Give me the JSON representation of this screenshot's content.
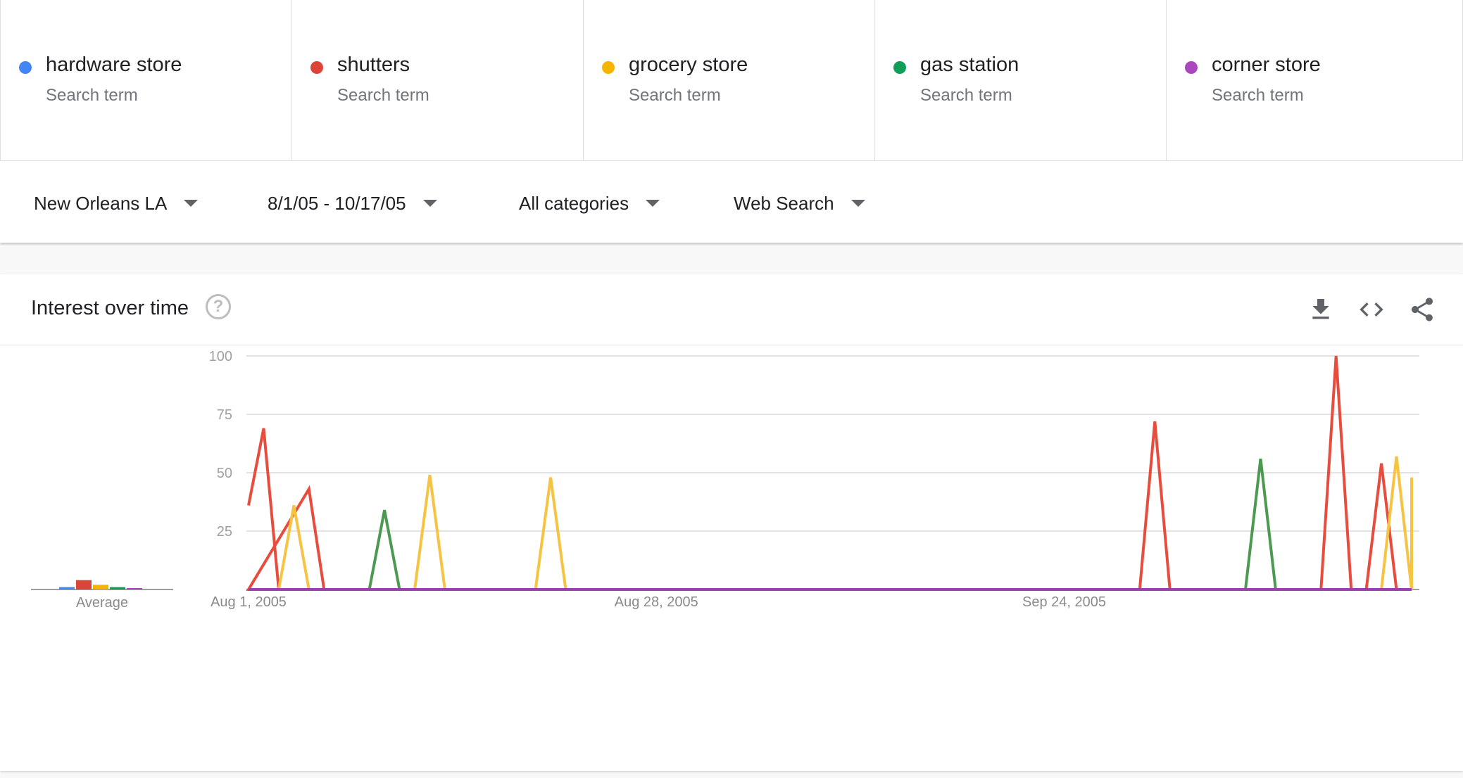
{
  "terms": [
    {
      "name": "hardware store",
      "sub": "Search term",
      "color": "#4285f4"
    },
    {
      "name": "shutters",
      "sub": "Search term",
      "color": "#db4437"
    },
    {
      "name": "grocery store",
      "sub": "Search term",
      "color": "#f4b400"
    },
    {
      "name": "gas station",
      "sub": "Search term",
      "color": "#0f9d58"
    },
    {
      "name": "corner store",
      "sub": "Search term",
      "color": "#ab47bc"
    }
  ],
  "filters": {
    "region": "New Orleans LA",
    "date_range": "8/1/05 - 10/17/05",
    "category": "All categories",
    "property": "Web Search"
  },
  "card": {
    "title": "Interest over time",
    "icons": [
      "help-icon",
      "download-icon",
      "embed-code-icon",
      "share-icon"
    ]
  },
  "average": {
    "label": "Average",
    "values": [
      1,
      4,
      2,
      1,
      0
    ]
  },
  "chart_data": {
    "type": "line",
    "title": "Interest over time",
    "xlabel": "",
    "ylabel": "",
    "ylim": [
      0,
      100
    ],
    "yticks": [
      "25",
      "50",
      "75",
      "100"
    ],
    "xtick_labels": [
      "Aug 1, 2005",
      "Aug 28, 2005",
      "Sep 24, 2005"
    ],
    "grid": true,
    "start_date": "2005-08-01",
    "end_date": "2005-10-17",
    "series": [
      {
        "name": "hardware store",
        "color": "#5b8def",
        "points": [
          [
            "2005-08-01",
            0
          ],
          [
            "2005-10-17",
            0
          ]
        ]
      },
      {
        "name": "shutters",
        "color": "#e84c3d",
        "points": [
          [
            "2005-08-01",
            36
          ],
          [
            "2005-08-02",
            69
          ],
          [
            "2005-08-03",
            0
          ],
          [
            "2005-08",
            0
          ],
          [
            "2005-08-05",
            43
          ],
          [
            "2005-08-06",
            0
          ],
          [
            "2005-09-29",
            0
          ],
          [
            "2005-09-30",
            72
          ],
          [
            "2005-10-01",
            0
          ],
          [
            "2005-10-11",
            0
          ],
          [
            "2005-10-12",
            100
          ],
          [
            "2005-10-13",
            0
          ],
          [
            "2005-10-14",
            0
          ],
          [
            "2005-10-15",
            54
          ],
          [
            "2005-10-16",
            0
          ],
          [
            "2005-10-17",
            0
          ]
        ]
      },
      {
        "name": "grocery store",
        "color": "#f6c342",
        "points": [
          [
            "2005-08-01",
            0
          ],
          [
            "2005-08-03",
            0
          ],
          [
            "2005-08-04",
            36
          ],
          [
            "2005-08-05",
            0
          ],
          [
            "2005-08-12",
            0
          ],
          [
            "2005-08-13",
            49
          ],
          [
            "2005-08-14",
            0
          ],
          [
            "2005-08-20",
            0
          ],
          [
            "2005-08-21",
            48
          ],
          [
            "2005-08-22",
            0
          ],
          [
            "2005-10-14",
            0
          ],
          [
            "2005-10-15",
            0
          ],
          [
            "2005-10-16",
            57
          ],
          [
            "2005-10-17",
            0
          ],
          [
            "2005-10-17",
            48
          ]
        ]
      },
      {
        "name": "gas station",
        "color": "#4b9a4f",
        "points": [
          [
            "2005-08-01",
            0
          ],
          [
            "2005-08-09",
            0
          ],
          [
            "2005-08-10",
            34
          ],
          [
            "2005-08-11",
            0
          ],
          [
            "2005-10-06",
            0
          ],
          [
            "2005-10-07",
            56
          ],
          [
            "2005-10-08",
            0
          ],
          [
            "2005-10-17",
            0
          ]
        ]
      },
      {
        "name": "corner store",
        "color": "#9c3fb0",
        "points": [
          [
            "2005-08-01",
            0
          ],
          [
            "2005-10-17",
            0
          ]
        ]
      }
    ]
  }
}
